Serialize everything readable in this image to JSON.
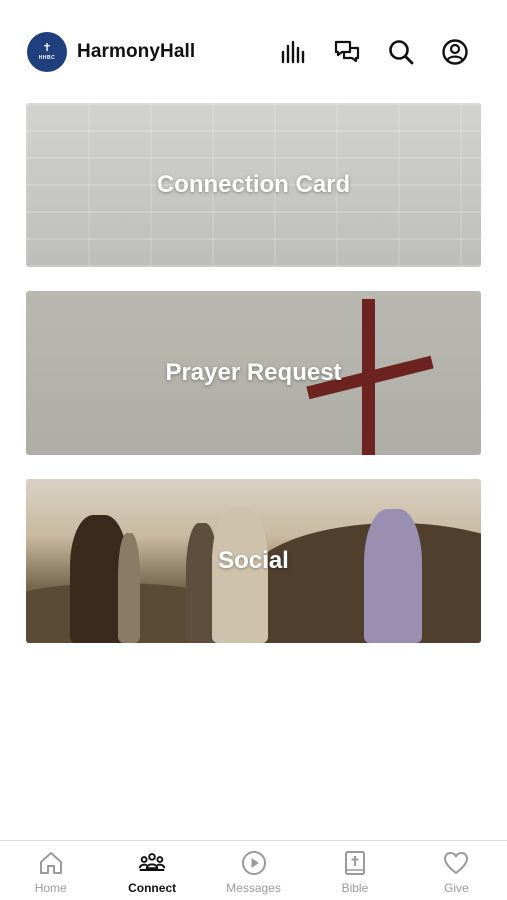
{
  "header": {
    "logo_cross": "✝",
    "logo_abbr": "HHBC",
    "title": "HarmonyHall"
  },
  "cards": [
    {
      "label": "Connection Card"
    },
    {
      "label": "Prayer Request"
    },
    {
      "label": "Social"
    }
  ],
  "tabbar": {
    "tabs": [
      {
        "label": "Home",
        "icon": "home-icon",
        "active": false
      },
      {
        "label": "Connect",
        "icon": "people-icon",
        "active": true
      },
      {
        "label": "Messages",
        "icon": "play-circle-icon",
        "active": false
      },
      {
        "label": "Bible",
        "icon": "bible-icon",
        "active": false
      },
      {
        "label": "Give",
        "icon": "heart-icon",
        "active": false
      }
    ]
  },
  "colors": {
    "logo_bg": "#1f3f7f",
    "active_tab": "#111111",
    "inactive_tab": "#9a9a9a",
    "cross": "#6d2320"
  }
}
